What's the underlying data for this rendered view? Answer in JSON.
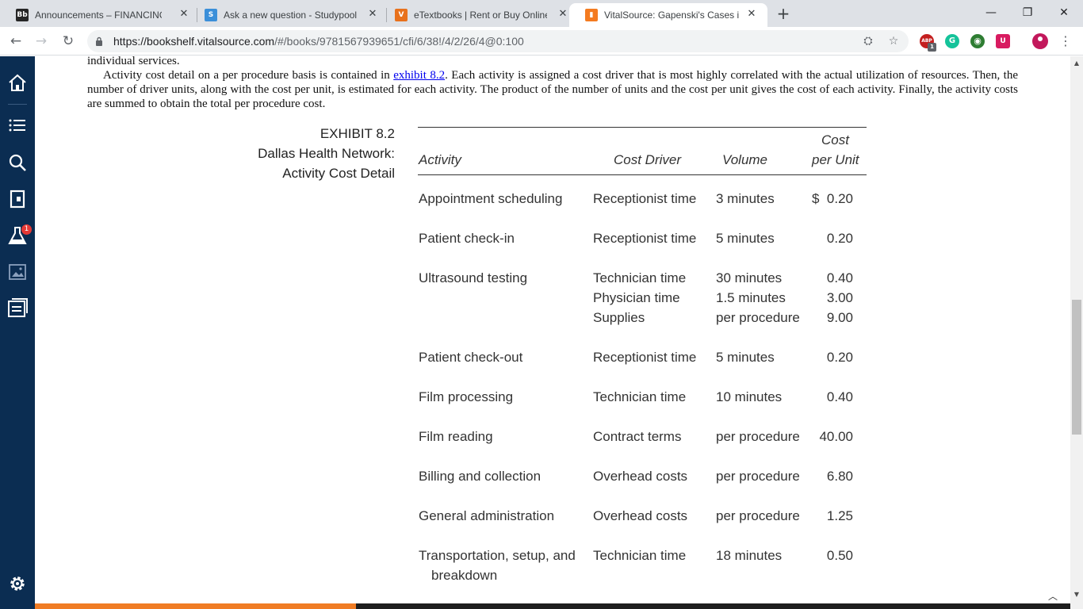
{
  "tabs": [
    {
      "title": "Announcements – FINANCING A",
      "favicon_text": "Bb",
      "favicon_color": "#262626",
      "active": false
    },
    {
      "title": "Ask a new question - Studypool",
      "favicon_text": "S",
      "favicon_color": "#3b8fd9",
      "active": false
    },
    {
      "title": "eTextbooks | Rent or Buy Online T",
      "favicon_text": "V",
      "favicon_color": "#e8711c",
      "active": false
    },
    {
      "title": "VitalSource: Gapenski's Cases in H",
      "favicon_text": "▮",
      "favicon_color": "#f47b20",
      "active": true
    }
  ],
  "new_tab_label": "+",
  "window_controls": {
    "minimize": "—",
    "restore": "❐",
    "close": "✕"
  },
  "address_bar": {
    "url_host": "https://bookshelf.vitalsource.com",
    "url_rest": "/#/books/9781567939651/cfi/6/38!/4/2/26/4@0:100"
  },
  "extensions": [
    {
      "name": "abp-icon",
      "text": "ABP",
      "color": "#c41f1f",
      "badge": "1"
    },
    {
      "name": "grammarly-icon",
      "text": "G",
      "color": "#15c39a"
    },
    {
      "name": "globe-extension-icon",
      "text": "◉",
      "color": "#2e7d32"
    },
    {
      "name": "shield-extension-icon",
      "text": "U",
      "color": "#d81b60"
    }
  ],
  "sidebar": {
    "notification_badge": "1"
  },
  "book": {
    "para_top": "individual services.",
    "para_main_before_link": "Activity cost detail on a per procedure basis is contained in ",
    "para_main_link": "exhibit 8.2",
    "para_main_after_link": ". Each activity is assigned a cost driver that is most highly correlated with the actual utilization of resources. Then, the number of driver units, along with the cost per unit, is estimated for each activity. The product of the number of units and the cost per unit gives the cost of each activity. Finally, the activity costs are summed to obtain the total per procedure cost.",
    "exhibit_number": "EXHIBIT 8.2",
    "exhibit_title_line1": "Dallas Health Network:",
    "exhibit_title_line2": "Activity Cost Detail",
    "table": {
      "headers": {
        "activity": "Activity",
        "cost_driver": "Cost Driver",
        "volume": "Volume",
        "cost_line1": "Cost",
        "cost_line2": "per Unit"
      },
      "rows": [
        {
          "activity": [
            "Appointment scheduling"
          ],
          "drivers": [
            "Receptionist time"
          ],
          "volumes": [
            "3 minutes"
          ],
          "costs": [
            "$  0.20"
          ]
        },
        {
          "activity": [
            "Patient check-in"
          ],
          "drivers": [
            "Receptionist time"
          ],
          "volumes": [
            "5 minutes"
          ],
          "costs": [
            "0.20"
          ]
        },
        {
          "activity": [
            "Ultrasound testing"
          ],
          "drivers": [
            "Technician time",
            "Physician time",
            "Supplies"
          ],
          "volumes": [
            "30 minutes",
            "1.5 minutes",
            "per procedure"
          ],
          "costs": [
            "0.40",
            "3.00",
            "9.00"
          ]
        },
        {
          "activity": [
            "Patient check-out"
          ],
          "drivers": [
            "Receptionist time"
          ],
          "volumes": [
            "5 minutes"
          ],
          "costs": [
            "0.20"
          ]
        },
        {
          "activity": [
            "Film processing"
          ],
          "drivers": [
            "Technician time"
          ],
          "volumes": [
            "10 minutes"
          ],
          "costs": [
            "0.40"
          ]
        },
        {
          "activity": [
            "Film reading"
          ],
          "drivers": [
            "Contract terms"
          ],
          "volumes": [
            "per procedure"
          ],
          "costs": [
            "40.00"
          ]
        },
        {
          "activity": [
            "Billing and collection"
          ],
          "drivers": [
            "Overhead costs"
          ],
          "volumes": [
            "per procedure"
          ],
          "costs": [
            "6.80"
          ]
        },
        {
          "activity": [
            "General administration"
          ],
          "drivers": [
            "Overhead costs"
          ],
          "volumes": [
            "per procedure"
          ],
          "costs": [
            "1.25"
          ]
        },
        {
          "activity": [
            "Transportation, setup, and",
            "breakdown"
          ],
          "drivers": [
            "Technician time"
          ],
          "volumes": [
            "18 minutes"
          ],
          "costs": [
            "0.50"
          ]
        }
      ]
    }
  },
  "reading_progress": 0.31,
  "collapse_label": "︿"
}
